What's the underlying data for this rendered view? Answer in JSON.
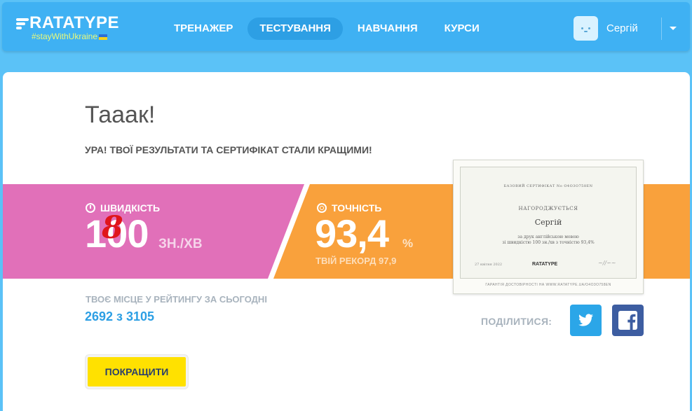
{
  "header": {
    "logo": "RATATYPE",
    "tagline": "#stayWithUkraine",
    "nav": [
      {
        "label": "ТРЕНАЖЕР",
        "active": false
      },
      {
        "label": "ТЕСТУВАННЯ",
        "active": true
      },
      {
        "label": "НАВЧАННЯ",
        "active": false
      },
      {
        "label": "КУРСИ",
        "active": false
      }
    ],
    "user_name": "Сергій"
  },
  "result": {
    "title": "Тааак!",
    "subtitle": "УРА! ТВОЇ РЕЗУЛЬТАТИ ТА СЕРТИФІКАТ СТАЛИ КРАЩИМИ!",
    "speed_label": "ШВИДКІСТЬ",
    "speed_value_prefix": "1",
    "speed_value_struck": "0",
    "speed_value_correction": "8",
    "speed_value_suffix": "0",
    "speed_unit": "ЗН./ХВ",
    "accuracy_label": "ТОЧНІСТЬ",
    "accuracy_value": "93,4",
    "accuracy_unit": "%",
    "accuracy_record": "ТВІЙ РЕКОРД 97,9",
    "rank_label": "ТВОЄ МІСЦЕ У РЕЙТИНГУ ЗА СЬОГОДНІ",
    "rank_value": "2692 з 3105",
    "share_label": "ПОДІЛИТИСЯ:",
    "improve_button": "ПОКРАЩИТИ"
  },
  "certificate": {
    "top": "БАЗОВИЙ СЕРТИФІКАТ No O4O3O758EN",
    "award": "НАГОРОДЖУЄТЬСЯ",
    "name": "Сергій",
    "desc1": "за друк англійською мовою",
    "desc2": "зі швидкістю 100 зн./хв з точністю 93,4%",
    "date": "27 квітня 2022",
    "logo": "RATATYPE",
    "verify": "ГАРАНТІЯ ДОСТОВІРНОСТІ НА WWW.RATATYPE.UA/O4O3O758EN"
  },
  "colors": {
    "header": "#3fb1f3",
    "speed_band": "#e170b9",
    "accuracy_band": "#f9a13c",
    "button": "#ffe100"
  }
}
